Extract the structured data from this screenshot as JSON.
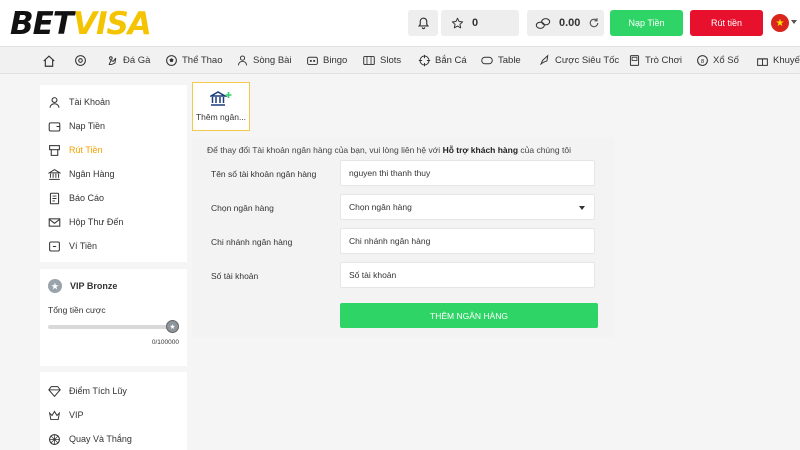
{
  "brand": {
    "part1": "BET",
    "part2": "VISA"
  },
  "header": {
    "points": "0",
    "balance": "0.00",
    "deposit_button": "Nạp Tiền",
    "withdraw_button": "Rút tiền",
    "flag_star": "★"
  },
  "nav": {
    "items": [
      "Đá Gà",
      "Thể Thao",
      "Sòng Bài",
      "Bingo",
      "Slots",
      "Bắn Cá",
      "Table",
      "Cược Siêu Tốc",
      "Trò Chơi",
      "Xổ Số",
      "Khuyến"
    ]
  },
  "sidebar": {
    "account_items": [
      "Tài Khoản",
      "Nạp Tiền",
      "Rút Tiền",
      "Ngân Hàng",
      "Báo Cáo",
      "Hộp Thư Đến",
      "Ví Tiền"
    ],
    "vip": {
      "level": "VIP Bronze",
      "bet_label": "Tổng tiền cược",
      "progress_text": "0/100000",
      "progress_fraction": 0
    },
    "extra_items": [
      "Điểm Tích Lũy",
      "VIP",
      "Quay Và Thắng"
    ]
  },
  "main": {
    "add_bank_tile": "Thêm ngân...",
    "notice_prefix": "Để thay đổi Tài khoản ngân hàng của bạn, vui lòng liên hệ với ",
    "notice_link": "Hỗ trợ khách hàng",
    "notice_suffix": " của chúng tôi",
    "form": {
      "account_name_label": "Tên số tài khoản ngân hàng",
      "account_name_value": "nguyen thi thanh thuy",
      "bank_label": "Chọn ngân hàng",
      "bank_value": "Chọn ngân hàng",
      "branch_label": "Chi nhánh ngân hàng",
      "branch_placeholder": "Chi nhánh ngân hàng",
      "account_number_label": "Số tài khoản",
      "account_number_placeholder": "Số tài khoản",
      "submit_button": "THÊM NGÂN HÀNG"
    }
  },
  "colors": {
    "accent_green": "#2fd466",
    "accent_red": "#e8112d",
    "brand_yellow": "#f5c400",
    "active_orange": "#f5a000"
  }
}
